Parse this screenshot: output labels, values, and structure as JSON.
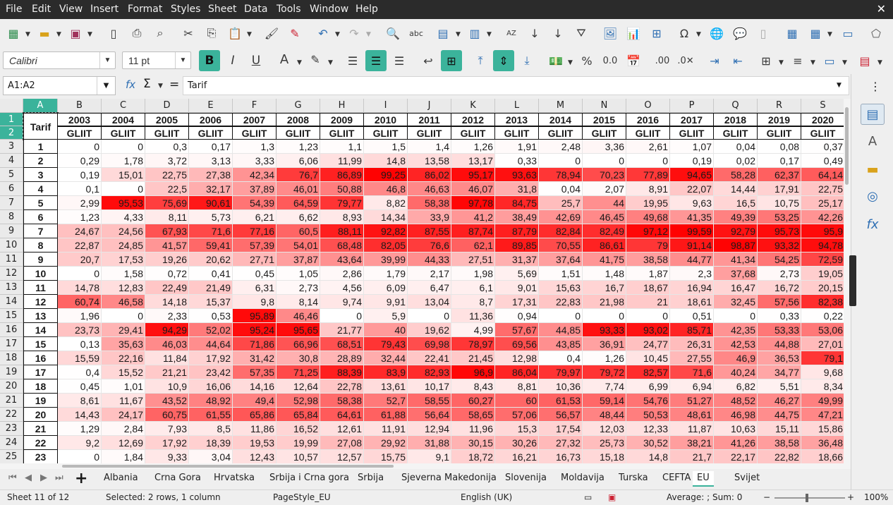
{
  "menu": [
    "File",
    "Edit",
    "View",
    "Insert",
    "Format",
    "Styles",
    "Sheet",
    "Data",
    "Tools",
    "Window",
    "Help"
  ],
  "toolbar": {
    "font_name": "Calibri",
    "font_size": "11 pt",
    "font_color": "#c9211e",
    "highlight_color": "#ffff00"
  },
  "formula": {
    "name_box": "A1:A2",
    "fx": "fx",
    "sum": "Σ",
    "equals": "=",
    "content": "Tarif"
  },
  "columns": [
    "A",
    "B",
    "C",
    "D",
    "E",
    "F",
    "G",
    "H",
    "I",
    "J",
    "K",
    "L",
    "M",
    "N",
    "O",
    "P",
    "Q",
    "R",
    "S"
  ],
  "header_tarif": "Tarif",
  "years": [
    "2003",
    "2004",
    "2005",
    "2006",
    "2007",
    "2008",
    "2009",
    "2010",
    "2011",
    "2012",
    "2013",
    "2014",
    "2015",
    "2016",
    "2017",
    "2018",
    "2019",
    "2020"
  ],
  "unit": "GLIIT",
  "row_numbers": [
    "1",
    "2",
    "3",
    "4",
    "5",
    "6",
    "7",
    "8",
    "9",
    "10",
    "11",
    "12",
    "13",
    "14",
    "15",
    "16",
    "17",
    "18",
    "19",
    "20",
    "21",
    "22",
    "23",
    "24",
    "25"
  ],
  "rows": [
    {
      "tarif": "1",
      "v": [
        "0",
        "0",
        "0,3",
        "0,17",
        "1,3",
        "1,23",
        "1,1",
        "1,5",
        "1,4",
        "1,26",
        "1,91",
        "2,48",
        "3,36",
        "2,61",
        "1,07",
        "0,04",
        "0,08",
        "0,37"
      ]
    },
    {
      "tarif": "2",
      "v": [
        "0,29",
        "1,78",
        "3,72",
        "3,13",
        "3,33",
        "6,06",
        "11,99",
        "14,8",
        "13,58",
        "13,17",
        "0,33",
        "0",
        "0",
        "0",
        "0,19",
        "0,02",
        "0,17",
        "0,49"
      ]
    },
    {
      "tarif": "3",
      "v": [
        "0,19",
        "15,01",
        "22,75",
        "27,38",
        "42,34",
        "76,7",
        "86,89",
        "99,25",
        "86,02",
        "95,17",
        "93,63",
        "78,94",
        "70,23",
        "77,89",
        "94,65",
        "58,28",
        "62,37",
        "64,14"
      ]
    },
    {
      "tarif": "4",
      "v": [
        "0,1",
        "0",
        "22,5",
        "32,17",
        "37,89",
        "46,01",
        "50,88",
        "46,8",
        "46,63",
        "46,07",
        "31,8",
        "0,04",
        "2,07",
        "8,91",
        "22,07",
        "14,44",
        "17,91",
        "22,75"
      ]
    },
    {
      "tarif": "5",
      "v": [
        "2,99",
        "95,53",
        "75,69",
        "90,61",
        "54,39",
        "64,59",
        "79,77",
        "8,82",
        "58,38",
        "97,78",
        "84,75",
        "25,7",
        "44",
        "19,95",
        "9,63",
        "16,5",
        "10,75",
        "25,17"
      ]
    },
    {
      "tarif": "6",
      "v": [
        "1,23",
        "4,33",
        "8,11",
        "5,73",
        "6,21",
        "6,62",
        "8,93",
        "14,34",
        "33,9",
        "41,2",
        "38,49",
        "42,69",
        "46,45",
        "49,68",
        "41,35",
        "49,39",
        "53,25",
        "42,26"
      ]
    },
    {
      "tarif": "7",
      "v": [
        "24,67",
        "24,56",
        "67,93",
        "71,6",
        "77,16",
        "60,5",
        "88,11",
        "92,82",
        "87,55",
        "87,74",
        "87,79",
        "82,84",
        "82,49",
        "97,12",
        "99,59",
        "92,79",
        "95,73",
        "95,9"
      ]
    },
    {
      "tarif": "8",
      "v": [
        "22,87",
        "24,85",
        "41,57",
        "59,41",
        "57,39",
        "54,01",
        "68,48",
        "82,05",
        "76,6",
        "62,1",
        "89,85",
        "70,55",
        "86,61",
        "79",
        "91,14",
        "98,87",
        "93,32",
        "94,78"
      ]
    },
    {
      "tarif": "9",
      "v": [
        "20,7",
        "17,53",
        "19,26",
        "20,62",
        "27,71",
        "37,87",
        "43,64",
        "39,99",
        "44,33",
        "27,51",
        "31,37",
        "37,64",
        "41,75",
        "38,58",
        "44,77",
        "41,34",
        "54,25",
        "72,59"
      ]
    },
    {
      "tarif": "10",
      "v": [
        "0",
        "1,58",
        "0,72",
        "0,41",
        "0,45",
        "1,05",
        "2,86",
        "1,79",
        "2,17",
        "1,98",
        "5,69",
        "1,51",
        "1,48",
        "1,87",
        "2,3",
        "37,68",
        "2,73",
        "19,05"
      ]
    },
    {
      "tarif": "11",
      "v": [
        "14,78",
        "12,83",
        "22,49",
        "21,49",
        "6,31",
        "2,73",
        "4,56",
        "6,09",
        "6,47",
        "6,1",
        "9,01",
        "15,63",
        "16,7",
        "18,67",
        "16,94",
        "16,47",
        "16,72",
        "20,15"
      ]
    },
    {
      "tarif": "12",
      "v": [
        "60,74",
        "46,58",
        "14,18",
        "15,37",
        "9,8",
        "8,14",
        "9,74",
        "9,91",
        "13,04",
        "8,7",
        "17,31",
        "22,83",
        "21,98",
        "21",
        "18,61",
        "32,45",
        "57,56",
        "82,38"
      ]
    },
    {
      "tarif": "13",
      "v": [
        "1,96",
        "0",
        "2,33",
        "0,53",
        "95,89",
        "46,46",
        "0",
        "5,9",
        "0",
        "11,36",
        "0,94",
        "0",
        "0",
        "0",
        "0,51",
        "0",
        "0,33",
        "0,22"
      ]
    },
    {
      "tarif": "14",
      "v": [
        "23,73",
        "29,41",
        "94,29",
        "52,02",
        "95,24",
        "95,65",
        "21,77",
        "40",
        "19,62",
        "4,99",
        "57,67",
        "44,85",
        "93,33",
        "93,02",
        "85,71",
        "42,35",
        "53,33",
        "53,06"
      ]
    },
    {
      "tarif": "15",
      "v": [
        "0,13",
        "35,63",
        "46,03",
        "44,64",
        "71,86",
        "66,96",
        "68,51",
        "79,43",
        "69,98",
        "78,97",
        "69,56",
        "43,85",
        "36,91",
        "24,77",
        "26,31",
        "42,53",
        "44,88",
        "27,01"
      ]
    },
    {
      "tarif": "16",
      "v": [
        "15,59",
        "22,16",
        "11,84",
        "17,92",
        "31,42",
        "30,8",
        "28,89",
        "32,44",
        "22,41",
        "21,45",
        "12,98",
        "0,4",
        "1,26",
        "10,45",
        "27,55",
        "46,9",
        "36,53",
        "79,1"
      ]
    },
    {
      "tarif": "17",
      "v": [
        "0,4",
        "15,52",
        "21,21",
        "23,42",
        "57,35",
        "71,25",
        "88,39",
        "83,9",
        "82,93",
        "96,9",
        "86,04",
        "79,97",
        "79,72",
        "82,57",
        "71,6",
        "40,24",
        "34,77",
        "9,68"
      ]
    },
    {
      "tarif": "18",
      "v": [
        "0,45",
        "1,01",
        "10,9",
        "16,06",
        "14,16",
        "12,64",
        "22,78",
        "13,61",
        "10,17",
        "8,43",
        "8,81",
        "10,36",
        "7,74",
        "6,99",
        "6,94",
        "6,82",
        "5,51",
        "8,34"
      ]
    },
    {
      "tarif": "19",
      "v": [
        "8,61",
        "11,67",
        "43,52",
        "48,92",
        "49,4",
        "52,98",
        "58,38",
        "52,7",
        "58,55",
        "60,27",
        "60",
        "61,53",
        "59,14",
        "54,76",
        "51,27",
        "48,52",
        "46,27",
        "49,99"
      ]
    },
    {
      "tarif": "20",
      "v": [
        "14,43",
        "24,17",
        "60,75",
        "61,55",
        "65,86",
        "65,84",
        "64,61",
        "61,88",
        "56,64",
        "58,65",
        "57,06",
        "56,57",
        "48,44",
        "50,53",
        "48,61",
        "46,98",
        "44,75",
        "47,21"
      ]
    },
    {
      "tarif": "21",
      "v": [
        "1,29",
        "2,84",
        "7,93",
        "8,5",
        "11,86",
        "16,52",
        "12,61",
        "11,91",
        "12,94",
        "11,96",
        "15,3",
        "17,54",
        "12,03",
        "12,33",
        "11,87",
        "10,63",
        "15,11",
        "15,86"
      ]
    },
    {
      "tarif": "22",
      "v": [
        "9,2",
        "12,69",
        "17,92",
        "18,39",
        "19,53",
        "19,99",
        "27,08",
        "29,92",
        "31,88",
        "30,15",
        "30,26",
        "27,32",
        "25,73",
        "30,52",
        "38,21",
        "41,26",
        "38,58",
        "36,48"
      ]
    },
    {
      "tarif": "23",
      "v": [
        "0",
        "1,84",
        "9,33",
        "3,04",
        "12,43",
        "10,57",
        "12,57",
        "15,75",
        "9,1",
        "18,72",
        "16,21",
        "16,73",
        "15,18",
        "14,8",
        "21,7",
        "22,17",
        "22,82",
        "18,66"
      ]
    }
  ],
  "sheet_tabs": [
    "Albania",
    "Crna Gora",
    "Hrvatska",
    "Srbija i Crna gora",
    "Srbija",
    "Sjeverna Makedonija",
    "Slovenija",
    "Moldavija",
    "Turska",
    "CEFTA",
    "EU",
    "Svijet"
  ],
  "active_tab": "EU",
  "status": {
    "sheet": "Sheet 11 of 12",
    "selection": "Selected: 2 rows, 1 column",
    "page_style": "PageStyle_EU",
    "language": "English (UK)",
    "calc": "Average: ; Sum: 0",
    "zoom": "100%"
  }
}
